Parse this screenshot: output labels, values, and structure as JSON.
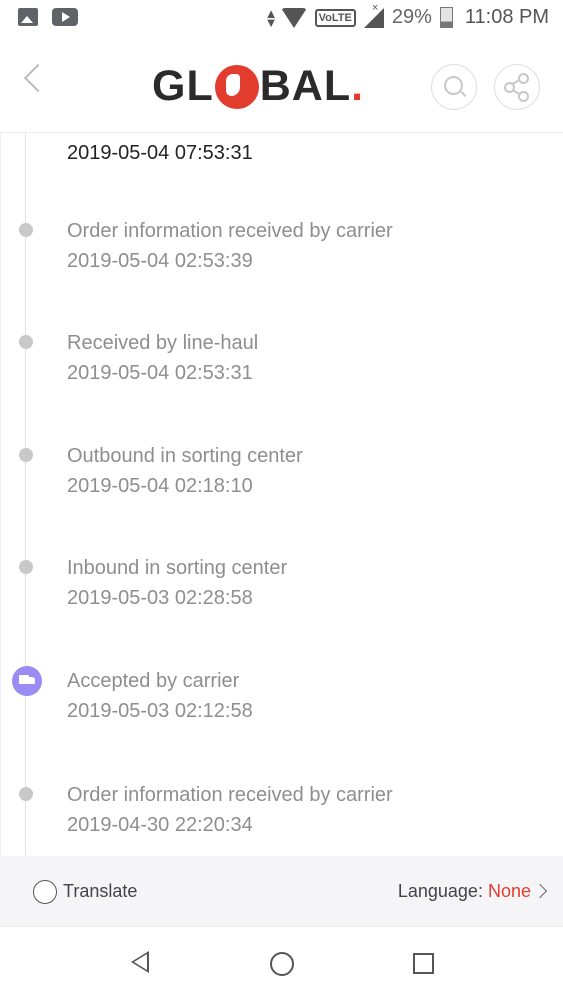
{
  "status_bar": {
    "battery": "29%",
    "time": "11:08 PM",
    "network": "VoLTE"
  },
  "header": {
    "logo_left": "GL",
    "logo_right": "BAL",
    "logo_dot": "."
  },
  "timeline": {
    "first_date": "2019-05-04 07:53:31",
    "events": [
      {
        "status": "Order information received by carrier",
        "date": "2019-05-04 02:53:39",
        "icon": "dot"
      },
      {
        "status": "Received by line-haul",
        "date": "2019-05-04 02:53:31",
        "icon": "dot"
      },
      {
        "status": "Outbound in sorting center",
        "date": "2019-05-04 02:18:10",
        "icon": "dot"
      },
      {
        "status": "Inbound in sorting center",
        "date": "2019-05-03 02:28:58",
        "icon": "dot"
      },
      {
        "status": "Accepted by carrier",
        "date": "2019-05-03 02:12:58",
        "icon": "truck-icon"
      },
      {
        "status": "Order information received by carrier",
        "date": "2019-04-30 22:20:34",
        "icon": "dot"
      }
    ]
  },
  "translate_bar": {
    "translate_label": "Translate",
    "language_label": "Language:",
    "language_value": "None"
  },
  "colors": {
    "accent": "#e23c2e",
    "truck_badge": "#9b8cf3",
    "muted_text": "#8e8e8e"
  }
}
